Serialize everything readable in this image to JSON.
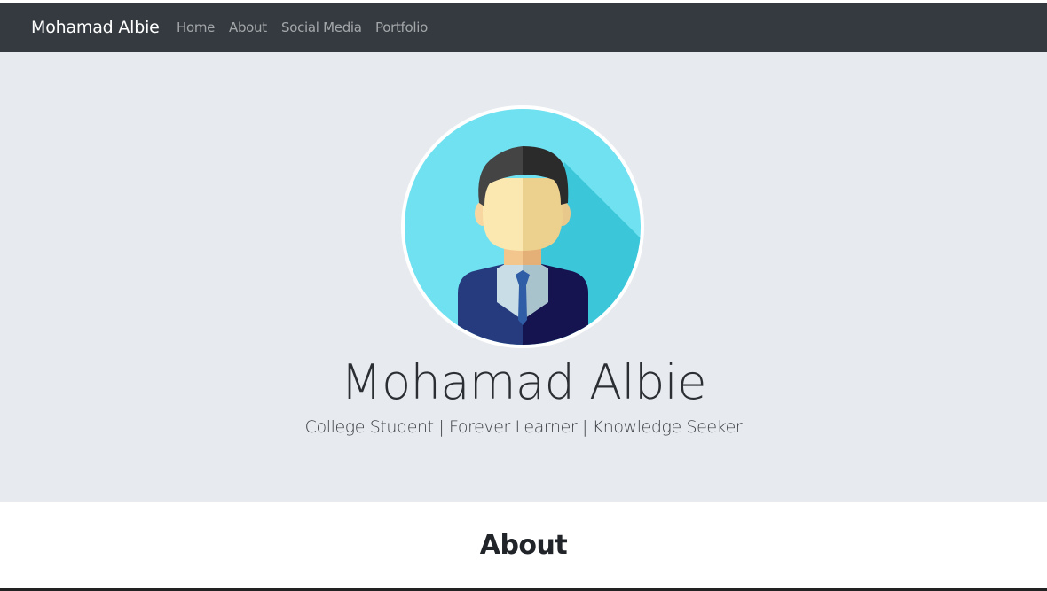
{
  "navbar": {
    "brand": "Mohamad Albie",
    "links": [
      {
        "label": "Home"
      },
      {
        "label": "About"
      },
      {
        "label": "Social Media"
      },
      {
        "label": "Portfolio"
      }
    ]
  },
  "hero": {
    "avatar_icon": "user-avatar-icon",
    "name": "Mohamad Albie",
    "tagline": "College Student | Forever Learner | Knowledge Seeker"
  },
  "about": {
    "heading": "About"
  },
  "colors": {
    "navbar_bg": "#343a40",
    "jumbotron_bg": "#e7eaee",
    "avatar_bg": "#70e1f0"
  }
}
